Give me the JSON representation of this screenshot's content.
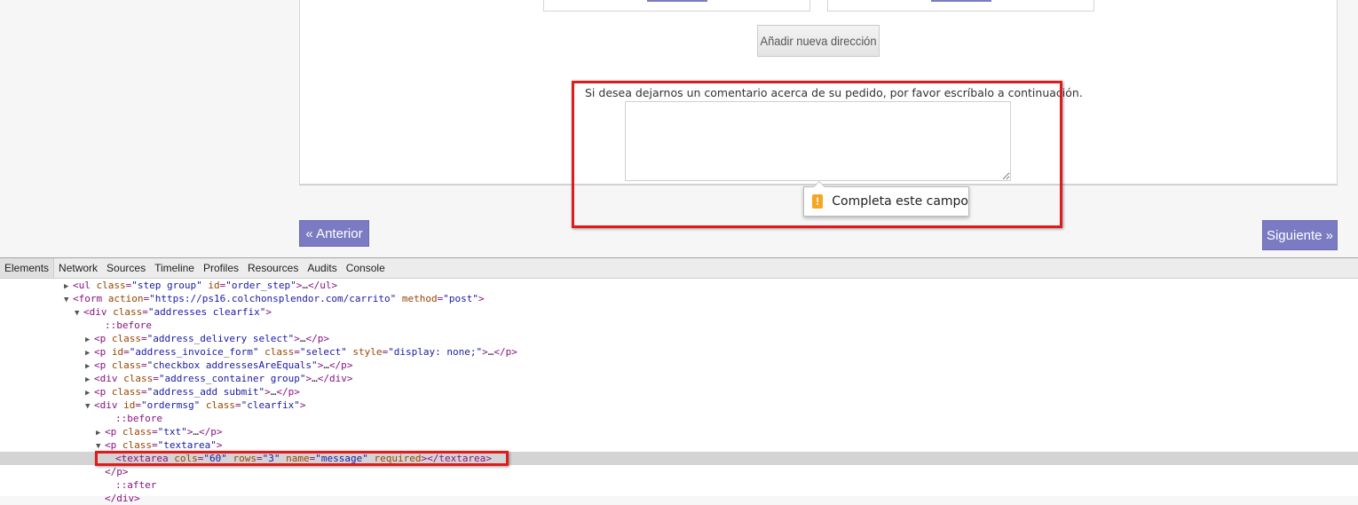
{
  "page": {
    "add_address_label": "Añadir nueva dirección",
    "comment_label": "Si desea dejarnos un comentario acerca de su pedido, por favor escríbalo a continuación.",
    "textarea_value": "",
    "validation_tooltip": "Completa este campo",
    "prev_label": "« Anterior",
    "next_label": "Siguiente »",
    "accent_color": "#7b7bc4",
    "highlight_color": "#e01b1b"
  },
  "devtools": {
    "tabs": [
      "Elements",
      "Network",
      "Sources",
      "Timeline",
      "Profiles",
      "Resources",
      "Audits",
      "Console"
    ],
    "active_tab": "Elements",
    "rows": [
      {
        "indent": 6,
        "tri": "▶",
        "html": "<ul class=\"step group\" id=\"order_step\">…</ul>"
      },
      {
        "indent": 6,
        "tri": "▼",
        "html": "<form action=\"https://ps16.colchonsplendor.com/carrito\" method=\"post\">"
      },
      {
        "indent": 7,
        "tri": "▼",
        "html": "<div class=\"addresses clearfix\">"
      },
      {
        "indent": 9,
        "tri": "",
        "html": "::before"
      },
      {
        "indent": 8,
        "tri": "▶",
        "html": "<p class=\"address_delivery select\">…</p>"
      },
      {
        "indent": 8,
        "tri": "▶",
        "html": "<p id=\"address_invoice_form\" class=\"select\" style=\"display: none;\">…</p>"
      },
      {
        "indent": 8,
        "tri": "▶",
        "html": "<p class=\"checkbox addressesAreEquals\">…</p>"
      },
      {
        "indent": 8,
        "tri": "▶",
        "html": "<div class=\"address_container group\">…</div>"
      },
      {
        "indent": 8,
        "tri": "▶",
        "html": "<p class=\"address_add submit\">…</p>"
      },
      {
        "indent": 8,
        "tri": "▼",
        "html": "<div id=\"ordermsg\" class=\"clearfix\">"
      },
      {
        "indent": 10,
        "tri": "",
        "html": "::before"
      },
      {
        "indent": 9,
        "tri": "▶",
        "html": "<p class=\"txt\">…</p>"
      },
      {
        "indent": 9,
        "tri": "▼",
        "html": "<p class=\"textarea\">"
      },
      {
        "indent": 10,
        "tri": "",
        "html": "<textarea cols=\"60\" rows=\"3\" name=\"message\" required></textarea>",
        "selected": true
      },
      {
        "indent": 9,
        "tri": "",
        "html": "</p>"
      },
      {
        "indent": 10,
        "tri": "",
        "html": "::after"
      },
      {
        "indent": 9,
        "tri": "",
        "html": "</div>"
      }
    ]
  }
}
